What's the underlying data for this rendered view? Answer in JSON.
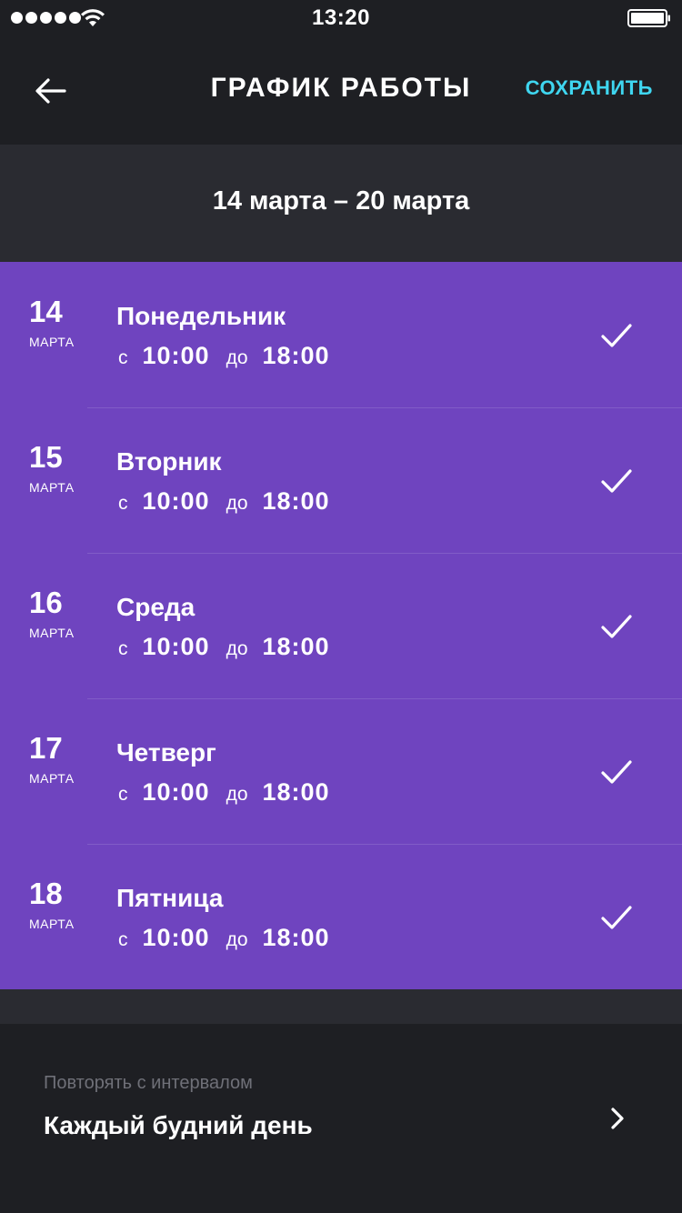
{
  "status_bar": {
    "time": "13:20",
    "signal_icon": "signal-dots-icon",
    "wifi_icon": "wifi-icon",
    "battery_icon": "battery-icon"
  },
  "header": {
    "back_icon": "arrow-left-icon",
    "title": "ГРАФИК РАБОТЫ",
    "save_label": "СОХРАНИТЬ",
    "accent_color": "#3fd6f0"
  },
  "week": {
    "range": "14 марта – 20 марта"
  },
  "days": [
    {
      "date": "14",
      "month": "МАРТА",
      "name": "Понедельник",
      "from_label": "с",
      "from": "10:00",
      "to_label": "до",
      "to": "18:00",
      "checked": true
    },
    {
      "date": "15",
      "month": "МАРТА",
      "name": "Вторник",
      "from_label": "с",
      "from": "10:00",
      "to_label": "до",
      "to": "18:00",
      "checked": true
    },
    {
      "date": "16",
      "month": "МАРТА",
      "name": "Среда",
      "from_label": "с",
      "from": "10:00",
      "to_label": "до",
      "to": "18:00",
      "checked": true
    },
    {
      "date": "17",
      "month": "МАРТА",
      "name": "Четверг",
      "from_label": "с",
      "from": "10:00",
      "to_label": "до",
      "to": "18:00",
      "checked": true
    },
    {
      "date": "18",
      "month": "МАРТА",
      "name": "Пятница",
      "from_label": "с",
      "from": "10:00",
      "to_label": "до",
      "to": "18:00",
      "checked": true
    }
  ],
  "repeat": {
    "label": "Повторять с интервалом",
    "value": "Каждый будний день",
    "chevron_icon": "chevron-right-icon"
  },
  "colors": {
    "background": "#1e1f23",
    "secondary_background": "#2a2b31",
    "selected_days": "#6f44bf"
  }
}
